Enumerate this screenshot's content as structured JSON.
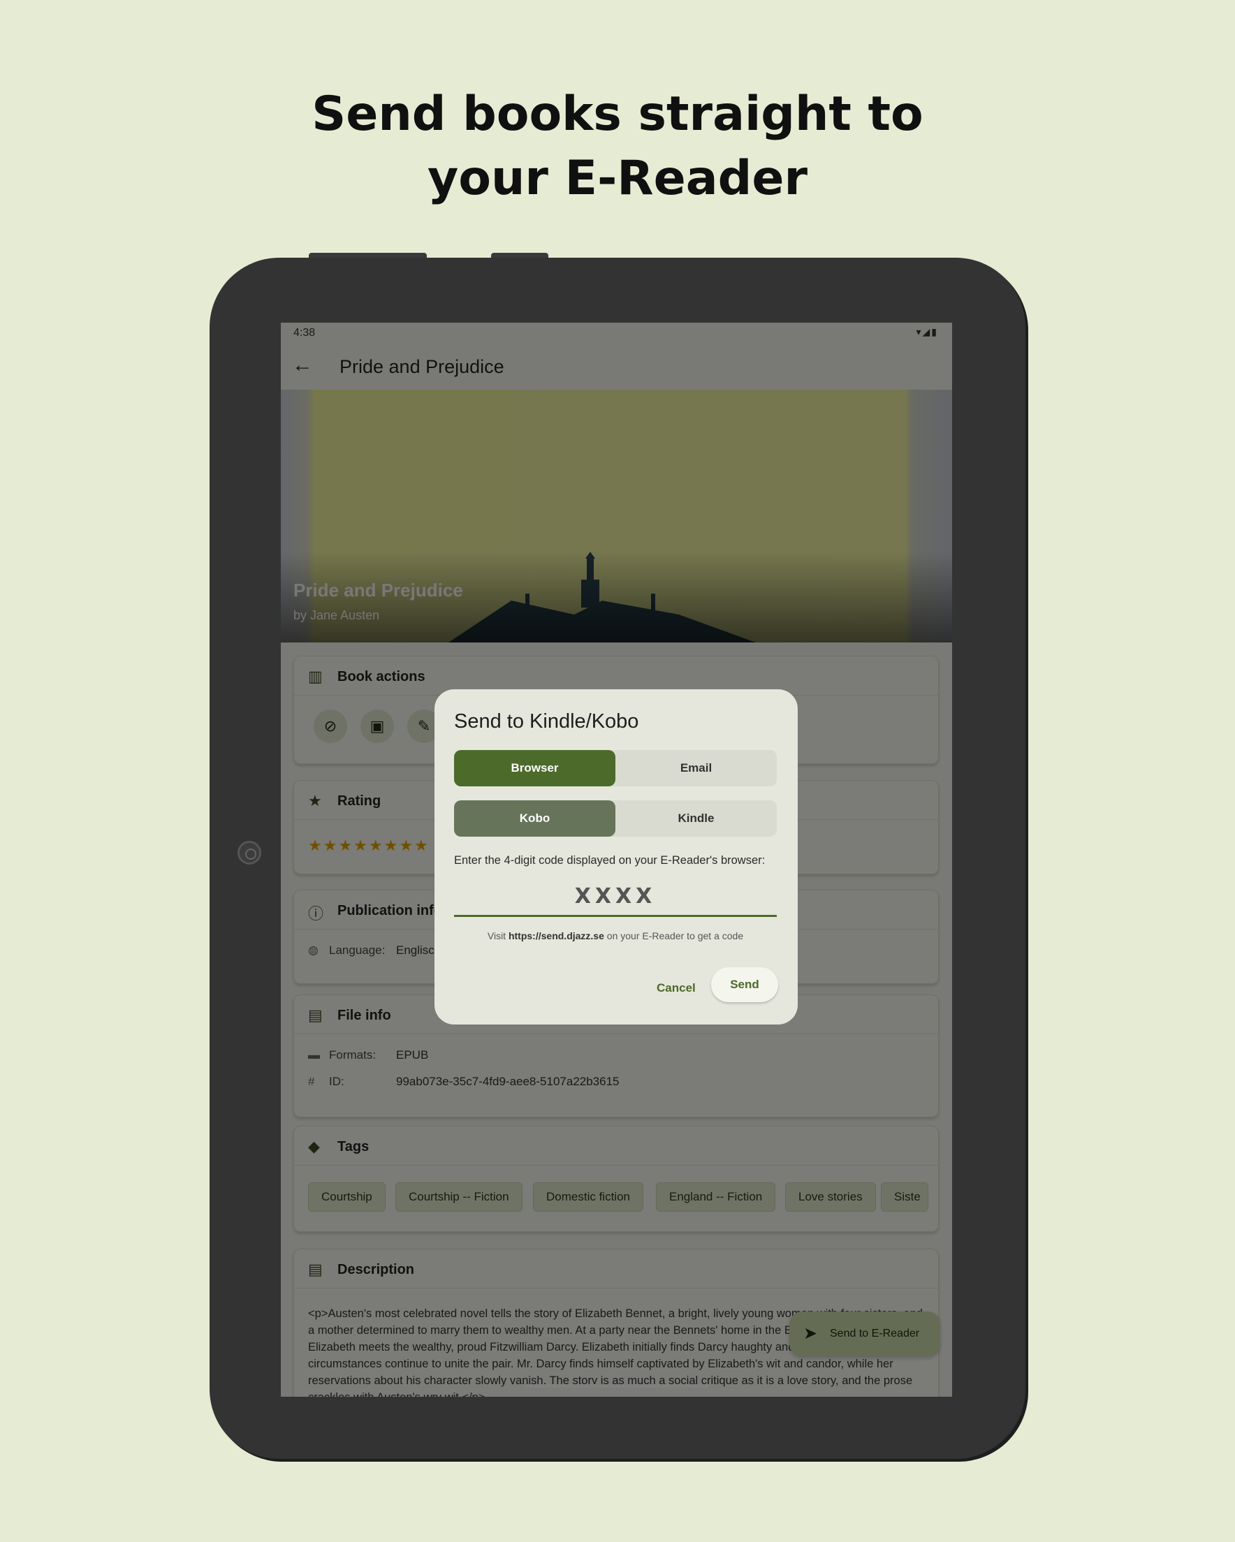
{
  "headline": {
    "line1": "Send books straight to",
    "line2": "your E-Reader"
  },
  "status": {
    "time": "4:38",
    "icons": "▾◢▮"
  },
  "appbar": {
    "title": "Pride and Prejudice"
  },
  "cover": {
    "title": "Pride and Prejudice",
    "author": "by Jane Austen"
  },
  "sections": {
    "book_actions": "Book actions",
    "rating": "Rating",
    "publication": "Publication info",
    "file": "File info",
    "tags": "Tags",
    "description": "Description"
  },
  "rating": {
    "stars": "★★★★★★★★"
  },
  "publication": {
    "language_label": "Language:",
    "language_value": "Englisch"
  },
  "file": {
    "formats_label": "Formats:",
    "formats_value": "EPUB",
    "id_label": "ID:",
    "id_value": "99ab073e-35c7-4fd9-aee8-5107a22b3615"
  },
  "tags": [
    "Courtship",
    "Courtship -- Fiction",
    "Domestic fiction",
    "England -- Fiction",
    "Love stories",
    "Siste"
  ],
  "description": "<p>Austen's most celebrated novel tells the story of Elizabeth Bennet, a bright, lively young woman with four sisters, and a mother determined to marry them to wealthy men. At a party near the Bennets' home in the English countryside, Elizabeth meets the wealthy, proud Fitzwilliam Darcy. Elizabeth initially finds Darcy haughty and intolerable, but circumstances continue to unite the pair. Mr. Darcy finds himself captivated by Elizabeth's wit and candor, while her reservations about his character slowly vanish. The story is as much a social critique as it is a love story, and the prose crackles with Austen's wry wit.</p>",
  "fab": {
    "label": "Send to E-Reader"
  },
  "dialog": {
    "title": "Send to Kindle/Kobo",
    "method_options": [
      "Browser",
      "Email"
    ],
    "device_options": [
      "Kobo",
      "Kindle"
    ],
    "prompt": "Enter the 4-digit code displayed on your E-Reader's browser:",
    "code_placeholder": "XXXX",
    "hint_prefix": "Visit",
    "hint_url": "https://send.djazz.se",
    "hint_suffix": "on your E-Reader to get a code",
    "cancel": "Cancel",
    "send": "Send"
  },
  "colors": {
    "background": "#e6ecd4",
    "primary": "#4c6a2a",
    "secondary": "#66745a",
    "dialog": "#e6e7dc"
  },
  "icons": {
    "back": "arrow-left-icon",
    "book_actions": "book-open-icon",
    "hide": "eye-off-icon",
    "archive": "archive-icon",
    "edit": "pencil-icon",
    "rating": "star-icon",
    "publication": "info-icon",
    "language": "globe-icon",
    "file": "file-icon",
    "formats": "folder-icon",
    "id": "hash-icon",
    "tags": "tag-icon",
    "description": "document-icon",
    "send": "send-icon"
  }
}
